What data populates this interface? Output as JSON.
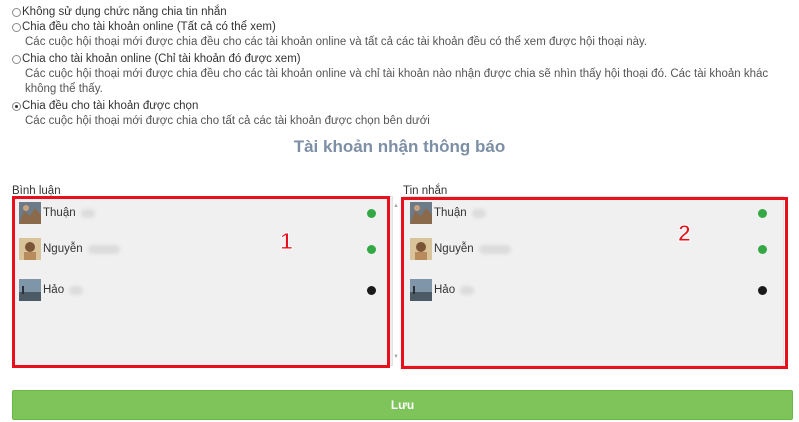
{
  "options": [
    {
      "label": "Không sử dụng chức năng chia tin nhắn",
      "description": "",
      "checked": false
    },
    {
      "label": "Chia đều cho tài khoản online (Tất cả có thể xem)",
      "description": "Các cuộc hội thoại mới được chia đều cho các tài khoản online và tất cả các tài khoản đều có thể xem được hội thoại này.",
      "checked": false
    },
    {
      "label": "Chia cho tài khoản online (Chỉ tài khoản đó được xem)",
      "description": "Các cuộc hội thoại mới được chia đều cho các tài khoản online và chỉ tài khoản nào nhận được chia sẽ nhìn thấy hội thoại đó. Các tài khoản khác không thể thấy.",
      "checked": false
    },
    {
      "label": "Chia đều cho tài khoản được chọn",
      "description": "Các cuộc hội thoại mới được chia cho tất cả các tài khoản được chọn bên dưới",
      "checked": true
    }
  ],
  "section_title": "Tài khoản nhận thông báo",
  "comments_panel": {
    "label": "Bình luận",
    "annotation": "1",
    "accounts": [
      {
        "name": "Thuận",
        "status": "online"
      },
      {
        "name": "Nguyễn",
        "status": "online"
      },
      {
        "name": "Hảo",
        "status": "offline"
      }
    ]
  },
  "messages_panel": {
    "label": "Tin nhắn",
    "annotation": "2",
    "accounts": [
      {
        "name": "Thuận",
        "status": "online"
      },
      {
        "name": "Nguyễn",
        "status": "online"
      },
      {
        "name": "Hảo",
        "status": "offline"
      }
    ]
  },
  "save_label": "Lưu",
  "colors": {
    "online": "#33a845",
    "offline": "#1a1a1a",
    "annotation": "#e8101c",
    "save_button": "#7ec45a",
    "title": "#7c8fa6"
  },
  "icons": {
    "scroll_up": "▲",
    "scroll_down": "▼"
  }
}
